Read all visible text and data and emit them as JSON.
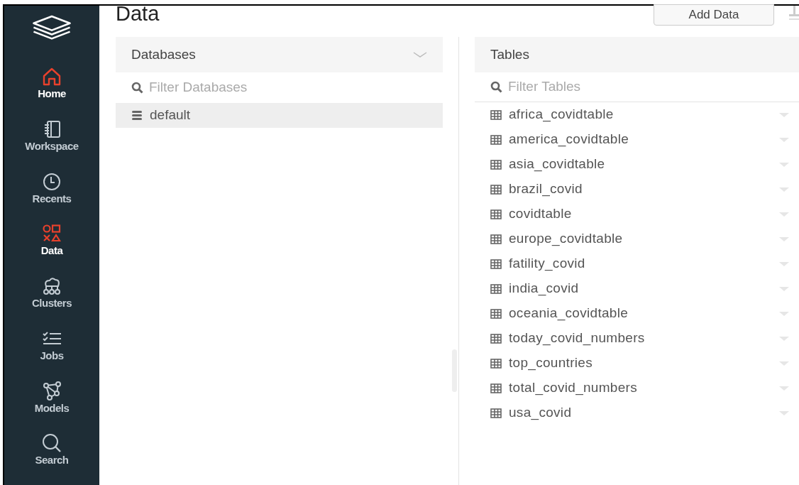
{
  "sidebar": {
    "items": [
      {
        "label": "Home",
        "active": true
      },
      {
        "label": "Workspace",
        "active": false
      },
      {
        "label": "Recents",
        "active": false
      },
      {
        "label": "Data",
        "active": true
      },
      {
        "label": "Clusters",
        "active": false
      },
      {
        "label": "Jobs",
        "active": false
      },
      {
        "label": "Models",
        "active": false
      },
      {
        "label": "Search",
        "active": false
      }
    ]
  },
  "page": {
    "title": "Data",
    "add_button": "Add Data"
  },
  "databases": {
    "header": "Databases",
    "filter": {
      "placeholder": "Filter Databases"
    },
    "items": [
      {
        "name": "default",
        "selected": true
      }
    ]
  },
  "tables": {
    "header": "Tables",
    "filter": {
      "placeholder": "Filter Tables"
    },
    "items": [
      {
        "name": "africa_covidtable"
      },
      {
        "name": "america_covidtable"
      },
      {
        "name": "asia_covidtable"
      },
      {
        "name": "brazil_covid"
      },
      {
        "name": "covidtable"
      },
      {
        "name": "europe_covidtable"
      },
      {
        "name": "fatility_covid"
      },
      {
        "name": "india_covid"
      },
      {
        "name": "oceania_covidtable"
      },
      {
        "name": "today_covid_numbers"
      },
      {
        "name": "top_countries"
      },
      {
        "name": "total_covid_numbers"
      },
      {
        "name": "usa_covid"
      }
    ]
  }
}
